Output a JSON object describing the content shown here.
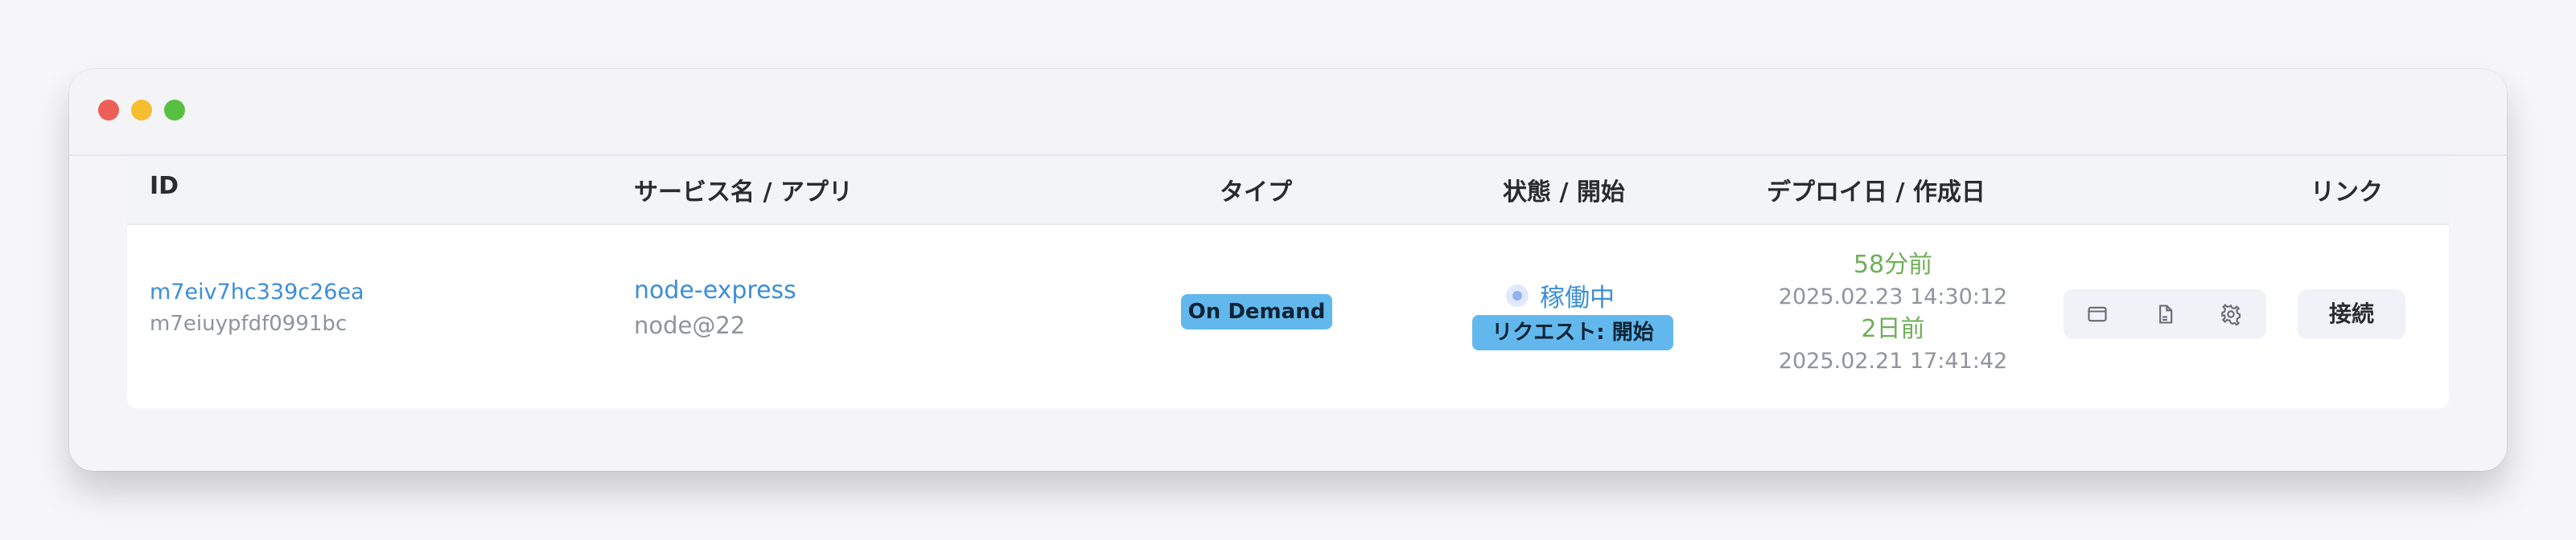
{
  "table": {
    "headers": {
      "id": "ID",
      "service": "サービス名 / アプリ",
      "type": "タイプ",
      "status": "状態 / 開始",
      "dates": "デプロイ日 / 作成日",
      "link": "リンク"
    },
    "rows": [
      {
        "id_primary": "m7eiv7hc339c26ea",
        "id_secondary": "m7eiuypfdf0991bc",
        "service_name": "node-express",
        "runtime": "node@22",
        "type": "On Demand",
        "status": "稼働中",
        "start_mode": "リクエスト: 開始",
        "deploy_relative": "58分前",
        "deploy_date": "2025.02.23 14:30:12",
        "created_relative": "2日前",
        "created_date": "2025.02.21 17:41:42",
        "connect_label": "接続"
      }
    ]
  },
  "icons": {
    "window": "window-icon",
    "document": "document-icon",
    "settings": "gear-icon",
    "status": "status-dot-icon"
  },
  "colors": {
    "accent_blue": "#3d8ed8",
    "badge_blue": "#62b8ec",
    "success_green": "#6eaf58",
    "muted_gray": "#8f939c"
  }
}
